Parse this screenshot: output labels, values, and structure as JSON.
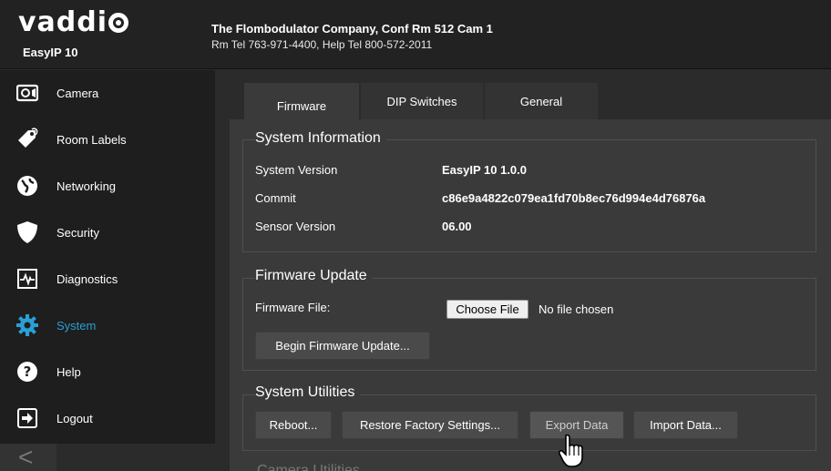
{
  "header": {
    "logo_text": "vaddi",
    "model": "EasyIP 10",
    "location": "The Flombodulator Company, Conf Rm 512 Cam 1",
    "phones": "Rm Tel 763-971-4400, Help Tel 800-572-2011"
  },
  "sidebar": {
    "items": [
      {
        "label": "Camera",
        "icon": "camera-icon"
      },
      {
        "label": "Room Labels",
        "icon": "tag-icon"
      },
      {
        "label": "Networking",
        "icon": "globe-icon"
      },
      {
        "label": "Security",
        "icon": "shield-icon"
      },
      {
        "label": "Diagnostics",
        "icon": "heartbeat-icon"
      },
      {
        "label": "System",
        "icon": "gear-icon",
        "active": true
      },
      {
        "label": "Help",
        "icon": "help-icon"
      },
      {
        "label": "Logout",
        "icon": "logout-icon"
      }
    ],
    "active_color": "#2a9fd6",
    "collapse_glyph": "<"
  },
  "tabs": [
    {
      "label": "Firmware",
      "active": true
    },
    {
      "label": "DIP Switches"
    },
    {
      "label": "General"
    }
  ],
  "system_information": {
    "legend": "System Information",
    "rows": [
      {
        "label": "System Version",
        "value": "EasyIP 10 1.0.0"
      },
      {
        "label": "Commit",
        "value": "c86e9a4822c079ea1fd70b8ec76d994e4d76876a"
      },
      {
        "label": "Sensor Version",
        "value": "06.00"
      }
    ]
  },
  "firmware_update": {
    "legend": "Firmware Update",
    "file_label": "Firmware File:",
    "choose_file_label": "Choose File",
    "file_status": "No file chosen",
    "begin_button": "Begin Firmware Update..."
  },
  "system_utilities": {
    "legend": "System Utilities",
    "buttons": {
      "reboot": "Reboot...",
      "restore": "Restore Factory Settings...",
      "export": "Export Data",
      "import": "Import Data..."
    }
  },
  "next_section_partial": "Camera Utilities"
}
